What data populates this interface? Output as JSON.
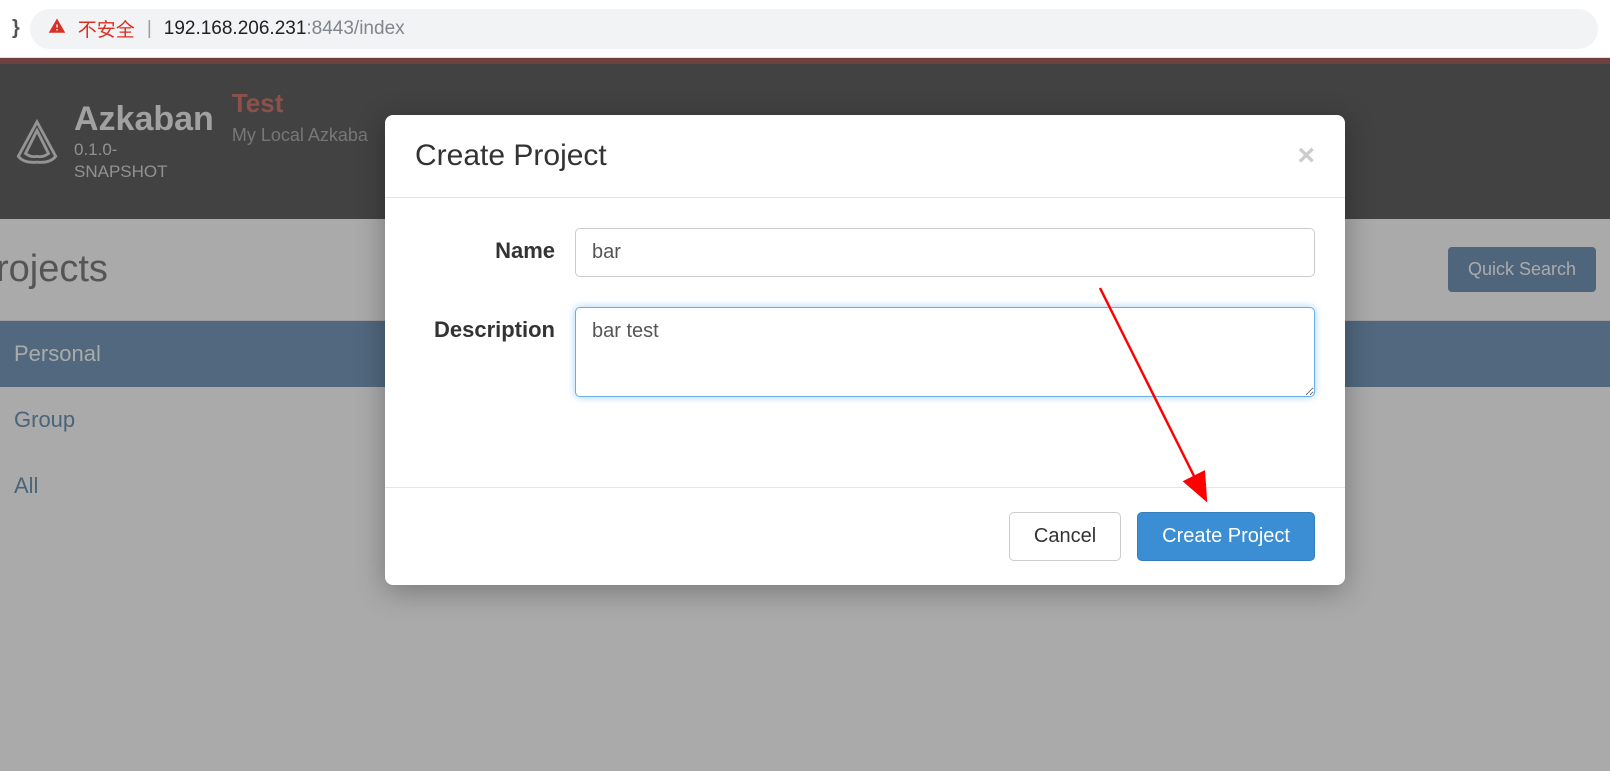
{
  "browser": {
    "insecure_label": "不安全",
    "host": "192.168.206.231",
    "port_path": ":8443/index"
  },
  "header": {
    "brand": "Azkaban",
    "version_line1": "0.1.0-",
    "version_line2": "SNAPSHOT",
    "env_label": "Test",
    "env_sub": "My Local Azkaba"
  },
  "page": {
    "title": "rojects",
    "quick_search": "Quick Search"
  },
  "sidebar": {
    "items": [
      {
        "label": "Personal",
        "active": true
      },
      {
        "label": "Group",
        "active": false
      },
      {
        "label": "All",
        "active": false
      }
    ]
  },
  "modal": {
    "title": "Create Project",
    "name_label": "Name",
    "name_value": "bar",
    "description_label": "Description",
    "description_value": "bar test",
    "cancel": "Cancel",
    "create": "Create Project"
  }
}
